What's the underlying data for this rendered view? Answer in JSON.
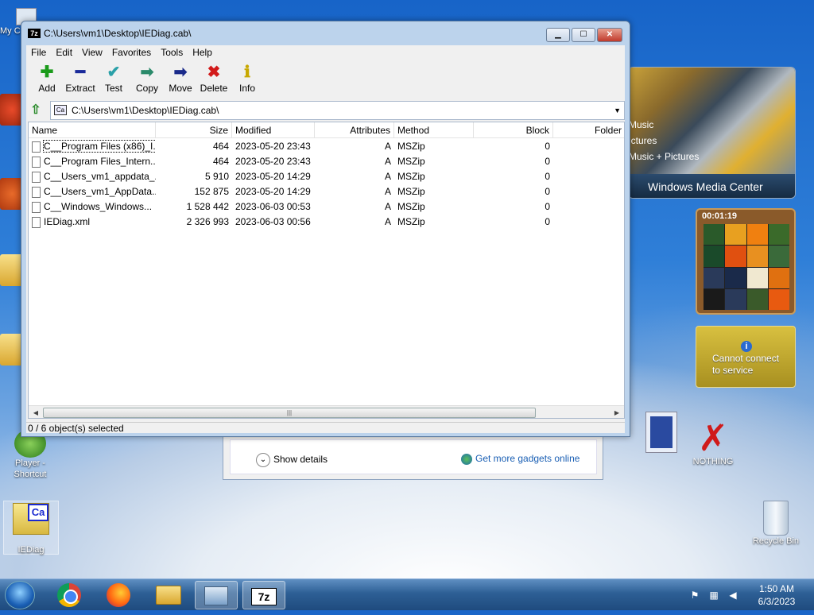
{
  "window": {
    "title": "C:\\Users\\vm1\\Desktop\\IEDiag.cab\\",
    "app_icon": "7z",
    "controls": {
      "minimize": "▁",
      "maximize": "☐",
      "close": "✕"
    }
  },
  "menu": [
    "File",
    "Edit",
    "View",
    "Favorites",
    "Tools",
    "Help"
  ],
  "toolbar": [
    {
      "label": "Add",
      "icon": "plus-icon",
      "glyph": "✚",
      "color": "#1a9a1a"
    },
    {
      "label": "Extract",
      "icon": "minus-icon",
      "glyph": "━",
      "color": "#1a2a9a"
    },
    {
      "label": "Test",
      "icon": "check-icon",
      "glyph": "✔",
      "color": "#2aa0a8"
    },
    {
      "label": "Copy",
      "icon": "arrow-right-icon",
      "glyph": "➡",
      "color": "#2a8a6a"
    },
    {
      "label": "Move",
      "icon": "arrow-right-icon",
      "glyph": "➡",
      "color": "#1a2a8a"
    },
    {
      "label": "Delete",
      "icon": "x-icon",
      "glyph": "✖",
      "color": "#d21a1a"
    },
    {
      "label": "Info",
      "icon": "info-icon",
      "glyph": "ℹ",
      "color": "#c8a800"
    }
  ],
  "address": {
    "path": "C:\\Users\\vm1\\Desktop\\IEDiag.cab\\",
    "icon_text": "Ca"
  },
  "columns": [
    "Name",
    "Size",
    "Modified",
    "Attributes",
    "Method",
    "Block",
    "Folder"
  ],
  "files": [
    {
      "name": "C__Program Files (x86)_I...",
      "size": "464",
      "modified": "2023-05-20 23:43",
      "attr": "A",
      "method": "MSZip",
      "block": "0"
    },
    {
      "name": "C__Program Files_Intern...",
      "size": "464",
      "modified": "2023-05-20 23:43",
      "attr": "A",
      "method": "MSZip",
      "block": "0"
    },
    {
      "name": "C__Users_vm1_appdata_...",
      "size": "5 910",
      "modified": "2023-05-20 14:29",
      "attr": "A",
      "method": "MSZip",
      "block": "0"
    },
    {
      "name": "C__Users_vm1_AppData...",
      "size": "152 875",
      "modified": "2023-05-20 14:29",
      "attr": "A",
      "method": "MSZip",
      "block": "0"
    },
    {
      "name": "C__Windows_Windows...",
      "size": "1 528 442",
      "modified": "2023-06-03 00:53",
      "attr": "A",
      "method": "MSZip",
      "block": "0"
    },
    {
      "name": "IEDiag.xml",
      "size": "2 326 993",
      "modified": "2023-06-03 00:56",
      "attr": "A",
      "method": "MSZip",
      "block": "0"
    }
  ],
  "status": "0 / 6 object(s) selected",
  "desktop_icons": {
    "player": "Player - Shortcut",
    "iediag": "IEDiag",
    "iediag_icon": "Ca",
    "nothing": "NOTHING",
    "recycle": "Recycle Bin",
    "my_partial": "My C"
  },
  "gadgets": {
    "wmc_items": [
      "Music",
      "ictures",
      "Music + Pictures"
    ],
    "wmc_title": "Windows Media Center",
    "puzzle_time": "00:01:19",
    "weather_msg1": "Cannot connect",
    "weather_msg2": "to service",
    "show_details": "Show details",
    "get_more": "Get more gadgets online"
  },
  "taskbar": {
    "sevenz_label": "7z"
  },
  "clock": {
    "time": "1:50 AM",
    "date": "6/3/2023"
  }
}
